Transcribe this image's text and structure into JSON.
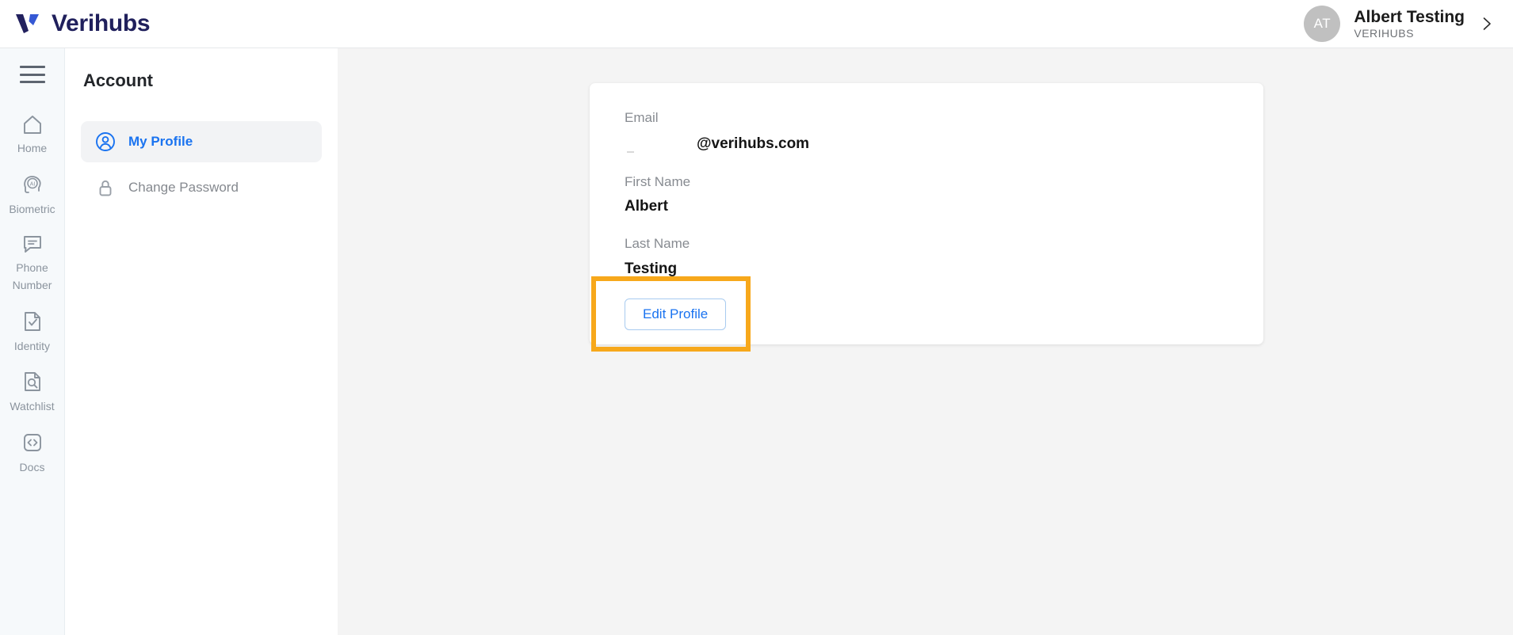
{
  "header": {
    "brand_name": "Verihubs",
    "brand_mark_icon": "verihubs-v-logo-icon",
    "user": {
      "avatar_initials": "AT",
      "name": "Albert Testing",
      "organization": "VERIHUBS",
      "expand_icon": "chevron-right-icon"
    }
  },
  "rail": {
    "menu_icon": "hamburger-menu-icon",
    "items": [
      {
        "label": "Home",
        "icon": "home-icon"
      },
      {
        "label": "Biometric",
        "icon": "face-ai-icon"
      },
      {
        "label": "Phone Number",
        "icon": "message-bubble-icon"
      },
      {
        "label": "Identity",
        "icon": "document-check-icon"
      },
      {
        "label": "Watchlist",
        "icon": "document-search-icon"
      },
      {
        "label": "Docs",
        "icon": "code-brackets-icon"
      }
    ]
  },
  "subnav": {
    "title": "Account",
    "items": [
      {
        "label": "My Profile",
        "icon": "user-circle-icon",
        "active": true
      },
      {
        "label": "Change Password",
        "icon": "lock-icon",
        "active": false
      }
    ]
  },
  "profile": {
    "fields": [
      {
        "label": "Email",
        "value": "@verihubs.com",
        "redacted_prefix": true
      },
      {
        "label": "First Name",
        "value": "Albert",
        "redacted_prefix": false
      },
      {
        "label": "Last Name",
        "value": "Testing",
        "redacted_prefix": false
      }
    ],
    "edit_button_label": "Edit Profile"
  },
  "colors": {
    "accent_blue": "#1a73f0",
    "brand_navy": "#20205c",
    "annotation_orange": "#f7a81b",
    "rail_background": "#f6f9fb",
    "main_background": "#f4f4f4"
  }
}
